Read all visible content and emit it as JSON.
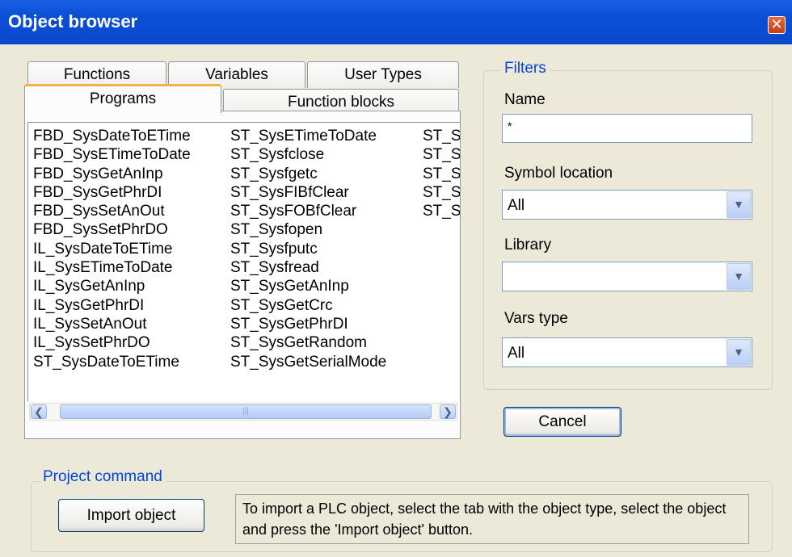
{
  "window": {
    "title": "Object browser"
  },
  "tabs": {
    "row1": [
      "Functions",
      "Variables",
      "User Types"
    ],
    "row2": [
      "Programs",
      "Function blocks"
    ],
    "active": "Programs"
  },
  "list": {
    "col1": [
      "FBD_SysDateToETime",
      "FBD_SysETimeToDate",
      "FBD_SysGetAnInp",
      "FBD_SysGetPhrDI",
      "FBD_SysSetAnOut",
      "FBD_SysSetPhrDO",
      "IL_SysDateToETime",
      "IL_SysETimeToDate",
      "IL_SysGetAnInp",
      "IL_SysGetPhrDI",
      "IL_SysSetAnOut",
      "IL_SysSetPhrDO",
      "ST_SysDateToETime"
    ],
    "col2": [
      "ST_SysETimeToDate",
      "ST_Sysfclose",
      "ST_Sysfgetc",
      "ST_SysFIBfClear",
      "ST_SysFOBfClear",
      "ST_Sysfopen",
      "ST_Sysfputc",
      "ST_Sysfread",
      "ST_SysGetAnInp",
      "ST_SysGetCrc",
      "ST_SysGetPhrDI",
      "ST_SysGetRandom",
      "ST_SysGetSerialMode"
    ],
    "col3": [
      "ST_S",
      "ST_S",
      "ST_S",
      "ST_S",
      "ST_S"
    ]
  },
  "filters": {
    "legend": "Filters",
    "name_label": "Name",
    "name_value": "*",
    "symbol_location_label": "Symbol location",
    "symbol_location_value": "All",
    "library_label": "Library",
    "library_value": "",
    "vars_type_label": "Vars type",
    "vars_type_value": "All"
  },
  "cancel_label": "Cancel",
  "project_command": {
    "legend": "Project command",
    "import_label": "Import object",
    "hint": "To import a PLC object, select the tab with the object type, select the object and press the 'Import object' button."
  },
  "icons": {
    "close": "close-icon",
    "scroll_left": "arrow-left-icon",
    "scroll_right": "arrow-right-icon",
    "dropdown": "chevron-down-icon"
  }
}
